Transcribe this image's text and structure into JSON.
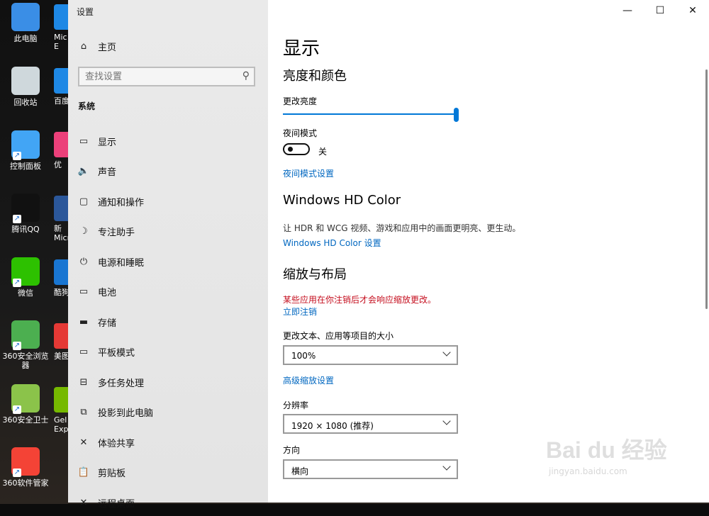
{
  "desktop": {
    "icons": [
      {
        "label": "此电脑",
        "icon": "computer-icon",
        "color": "#3a8ee6"
      },
      {
        "label": "回收站",
        "icon": "recycle-bin-icon",
        "color": "#cfd8dc"
      },
      {
        "label": "控制面板",
        "icon": "control-panel-icon",
        "color": "#42a5f5"
      },
      {
        "label": "腾讯QQ",
        "icon": "qq-icon",
        "color": "#111111"
      },
      {
        "label": "微信",
        "icon": "wechat-icon",
        "color": "#2dc100"
      },
      {
        "label": "360安全浏览器",
        "icon": "360-browser-icon",
        "color": "#4caf50"
      },
      {
        "label": "360安全卫士",
        "icon": "360-security-icon",
        "color": "#8bc34a"
      },
      {
        "label": "360软件管家",
        "icon": "360-software-icon",
        "color": "#f44336"
      }
    ],
    "peek": [
      {
        "label": "Mic E",
        "color": "#1e88e5"
      },
      {
        "label": "百度",
        "color": "#1e88e5"
      },
      {
        "label": "优",
        "color": "#ec407a"
      },
      {
        "label": "新 Micr",
        "color": "#2b579a"
      },
      {
        "label": "酷狗",
        "color": "#1976d2"
      },
      {
        "label": "美图",
        "color": "#e53935"
      },
      {
        "label": "Gel Expe",
        "color": "#76b900"
      }
    ]
  },
  "window": {
    "title": "设置",
    "controls": {
      "minimize": "—",
      "maximize": "☐",
      "close": "✕"
    }
  },
  "nav": {
    "home": "主页",
    "search_placeholder": "查找设置",
    "section": "系统",
    "items": [
      {
        "label": "显示",
        "icon": "monitor-icon",
        "glyph": "▭"
      },
      {
        "label": "声音",
        "icon": "speaker-icon",
        "glyph": "🔈"
      },
      {
        "label": "通知和操作",
        "icon": "notification-icon",
        "glyph": "▢"
      },
      {
        "label": "专注助手",
        "icon": "moon-icon",
        "glyph": "☽"
      },
      {
        "label": "电源和睡眠",
        "icon": "power-icon",
        "glyph": "⏻"
      },
      {
        "label": "电池",
        "icon": "battery-icon",
        "glyph": "▭"
      },
      {
        "label": "存储",
        "icon": "storage-icon",
        "glyph": "▬"
      },
      {
        "label": "平板模式",
        "icon": "tablet-icon",
        "glyph": "▭"
      },
      {
        "label": "多任务处理",
        "icon": "multitask-icon",
        "glyph": "⊟"
      },
      {
        "label": "投影到此电脑",
        "icon": "project-icon",
        "glyph": "⧉"
      },
      {
        "label": "体验共享",
        "icon": "share-icon",
        "glyph": "✕"
      },
      {
        "label": "剪贴板",
        "icon": "clipboard-icon",
        "glyph": "📋"
      },
      {
        "label": "远程桌面",
        "icon": "remote-desktop-icon",
        "glyph": "✕"
      }
    ]
  },
  "content": {
    "page_title": "显示",
    "brightness_section": "亮度和颜色",
    "brightness_label": "更改亮度",
    "brightness_value": 1.0,
    "night_mode_label": "夜间模式",
    "night_mode_state": "关",
    "night_mode_link": "夜间模式设置",
    "hdr_section": "Windows HD Color",
    "hdr_desc": "让 HDR 和 WCG 视频、游戏和应用中的画面更明亮、更生动。",
    "hdr_link": "Windows HD Color 设置",
    "scale_section": "缩放与布局",
    "scale_warning": "某些应用在你注销后才会响应缩放更改。",
    "signout_link": "立即注销",
    "scale_label": "更改文本、应用等项目的大小",
    "scale_value": "100%",
    "advanced_scale_link": "高级缩放设置",
    "resolution_label": "分辨率",
    "resolution_value": "1920 × 1080 (推荐)",
    "orientation_label": "方向",
    "orientation_value": "横向"
  },
  "watermark": {
    "logo": "Bai du 经验",
    "sub": "jingyan.baidu.com"
  }
}
